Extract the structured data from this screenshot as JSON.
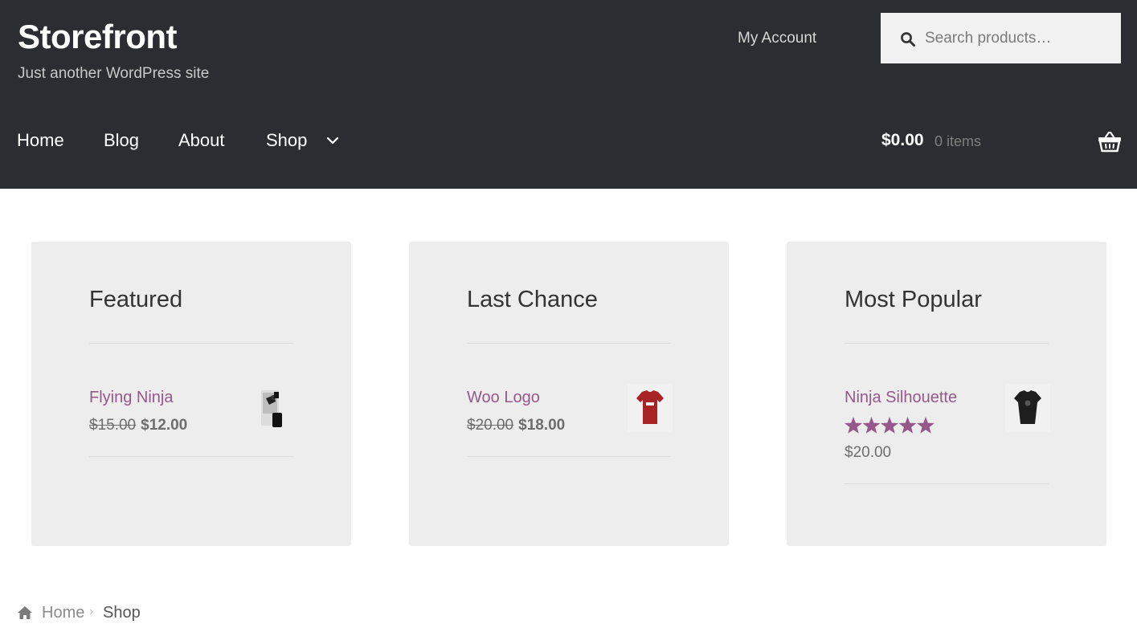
{
  "header": {
    "site_title": "Storefront",
    "tagline": "Just another WordPress site",
    "my_account": "My Account",
    "search_placeholder": "Search products…",
    "background": "#2c2d33"
  },
  "nav": {
    "items": [
      {
        "label": "Home"
      },
      {
        "label": "Blog"
      },
      {
        "label": "About"
      },
      {
        "label": "Shop"
      }
    ]
  },
  "cart": {
    "amount": "$0.00",
    "count": "0 items"
  },
  "widgets": [
    {
      "title": "Featured",
      "product": "Flying Ninja",
      "old_price": "$15.00",
      "new_price": "$12.00",
      "thumb": "poster-image"
    },
    {
      "title": "Last Chance",
      "product": "Woo Logo",
      "old_price": "$20.00",
      "new_price": "$18.00",
      "thumb": "red-tshirt-image"
    },
    {
      "title": "Most Popular",
      "product": "Ninja Silhouette",
      "rating": 5,
      "rating_max": 5,
      "price": "$20.00",
      "thumb": "black-tshirt-image"
    }
  ],
  "breadcrumb": {
    "home": "Home",
    "current": "Shop"
  },
  "colors": {
    "accent": "#96588a",
    "card_bg": "#ededed"
  }
}
